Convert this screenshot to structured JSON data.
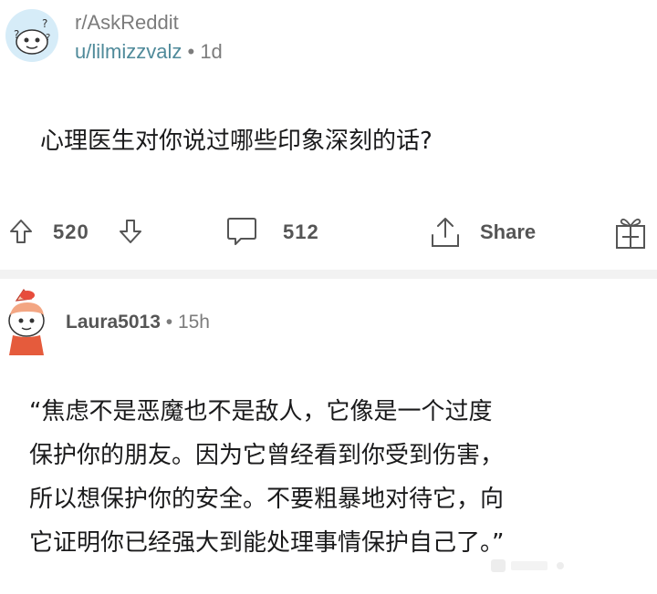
{
  "post": {
    "subreddit": "r/AskReddit",
    "author": "u/lilmizzvalz",
    "separator": "•",
    "age": "1d",
    "title": "心理医生对你说过哪些印象深刻的话?"
  },
  "actions": {
    "upvotes": "520",
    "comments": "512",
    "share_label": "Share"
  },
  "comment": {
    "author": "Laura5013",
    "separator": "•",
    "age": "15h",
    "body_lines": [
      "“焦虑不是恶魔也不是敌人，它像是一个过度",
      "保护你的朋友。因为它曾经看到你受到伤害，",
      "所以想保护你的安全。不要粗暴地对待它，向",
      "它证明你已经强大到能处理事情保护自己了。”"
    ]
  },
  "icons": {
    "subreddit_avatar": "reddit-snoo-avatar-icon",
    "upvote": "arrow-up-icon",
    "downvote": "arrow-down-icon",
    "comments": "speech-bubble-icon",
    "share": "share-icon",
    "award": "gift-award-icon",
    "comment_avatar": "user-avatar-icon"
  },
  "colors": {
    "username": "#4f8a9a",
    "muted": "#7c7c7c",
    "avatar_bg": "#d6ecf8"
  }
}
